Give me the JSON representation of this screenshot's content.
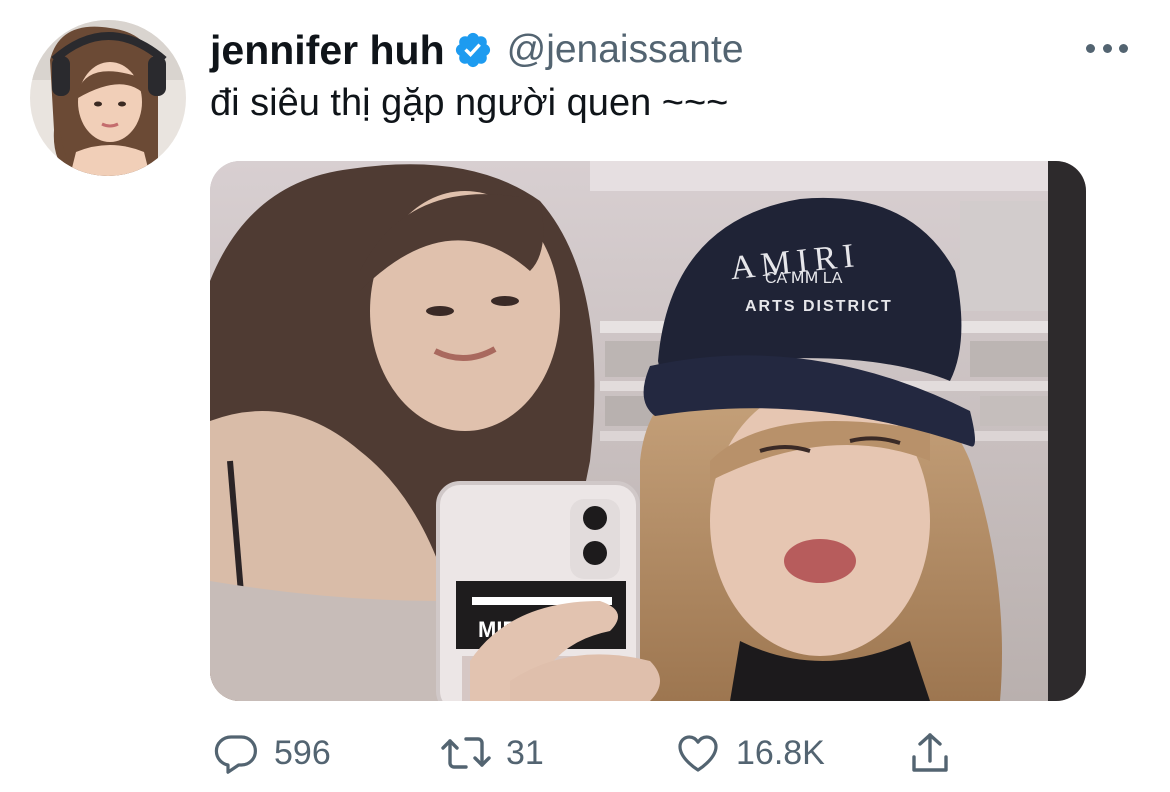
{
  "tweet": {
    "author": {
      "display_name": "jennifer huh",
      "handle": "@jenaissante",
      "verified": true
    },
    "text": "đi siêu thị gặp người quen ~~~",
    "media": {
      "cap_text_top": "AMIRI",
      "cap_text_mid": "CA ⅯⅯ LA",
      "cap_text_bottom": "ARTS DISTRICT",
      "phone_sticker_text": "MIFAR"
    },
    "stats": {
      "replies": "596",
      "retweets": "31",
      "likes": "16.8K"
    }
  },
  "icons": {
    "verified": "verified-badge-icon",
    "more": "more-options-icon",
    "reply": "reply-icon",
    "retweet": "retweet-icon",
    "like": "heart-icon",
    "share": "share-icon"
  },
  "colors": {
    "verified_blue": "#1d9bf0",
    "text_primary": "#0f1419",
    "text_secondary": "#536471"
  }
}
